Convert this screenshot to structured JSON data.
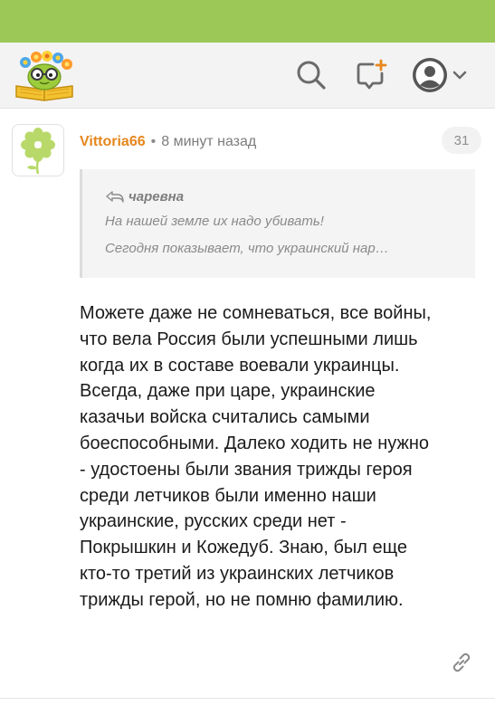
{
  "colors": {
    "top_bar": "#9bc857",
    "author": "#e6861d",
    "header_bg": "#f3f3f3"
  },
  "header": {
    "logo": "sunflower-glasses-book-logo",
    "icons": [
      "search-icon",
      "compose-plus-icon",
      "user-avatar-icon",
      "chevron-down-icon"
    ]
  },
  "comment": {
    "avatar_icon": "flower-icon",
    "author": "Vittoria66",
    "separator": "•",
    "time": "8 минут назад",
    "count": "31",
    "quote": {
      "author": "чаревна",
      "lines": [
        "На нашей земле их надо убивать!",
        "Сегодня  показывает,  что  украинский  нар…"
      ]
    },
    "body_lines": [
      "Можете даже не сомневаться, все войны,",
      "что вела Россия были успешными лишь",
      "когда их в составе воевали украинцы.",
      "Всегда, даже при царе, украинские",
      "казачьи войска считались самыми",
      "боеспособными. Далеко ходить не нужно",
      "- удостоены были звания трижды героя",
      "среди летчиков были именно наши",
      "украинские, русских среди нет -",
      "Покрышкин и Кожедуб. Знаю, был еще",
      "кто-то третий из украинских летчиков",
      "трижды герой, но не помню фамилию."
    ],
    "link_icon": "link-icon"
  }
}
